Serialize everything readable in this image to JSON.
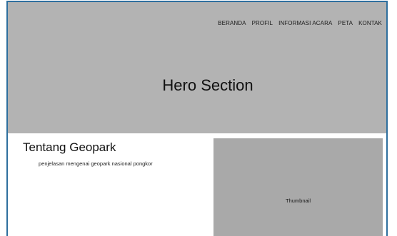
{
  "nav": {
    "items": [
      {
        "label": "BERANDA"
      },
      {
        "label": "PROFIL"
      },
      {
        "label": "INFORMASI ACARA"
      },
      {
        "label": "PETA"
      },
      {
        "label": "KONTAK"
      }
    ]
  },
  "hero": {
    "title": "Hero Section"
  },
  "about": {
    "title": "Tentang Geopark",
    "description": "penjelasan mengenai geopark nasional pongkor"
  },
  "thumbnail": {
    "label": "Thumbnail"
  },
  "colors": {
    "hero_bg": "#b3b3b3",
    "thumbnail_bg": "#a9a9a9",
    "frame_border": "#2e6f9e"
  }
}
